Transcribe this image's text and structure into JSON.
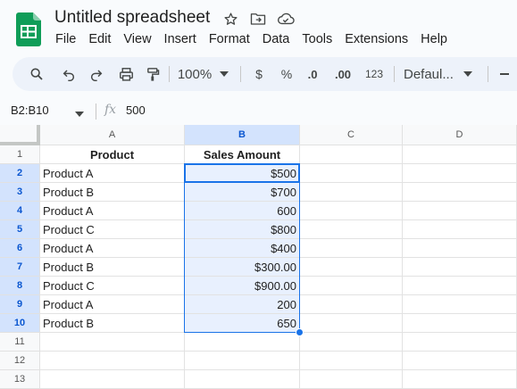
{
  "app": {
    "title": "Untitled spreadsheet",
    "menu": [
      "File",
      "Edit",
      "View",
      "Insert",
      "Format",
      "Data",
      "Tools",
      "Extensions",
      "Help"
    ]
  },
  "toolbar": {
    "zoom": "100%",
    "currency": "$",
    "percent": "%",
    "decrease_decimal": ".0",
    "increase_decimal": ".00",
    "number_format": "123",
    "font": "Defaul..."
  },
  "formula_bar": {
    "name_box": "B2:B10",
    "fx": "fx",
    "value": "500"
  },
  "grid": {
    "columns": [
      "A",
      "B",
      "C",
      "D"
    ],
    "rows": [
      "1",
      "2",
      "3",
      "4",
      "5",
      "6",
      "7",
      "8",
      "9",
      "10",
      "11",
      "12",
      "13"
    ],
    "cells": [
      [
        "Product",
        "Sales Amount"
      ],
      [
        "Product A",
        "$500"
      ],
      [
        "Product B",
        "$700"
      ],
      [
        "Product A",
        "600"
      ],
      [
        "Product C",
        "$800"
      ],
      [
        "Product A",
        "$400"
      ],
      [
        "Product B",
        "$300.00"
      ],
      [
        "Product C",
        "$900.00"
      ],
      [
        "Product A",
        "200"
      ],
      [
        "Product B",
        "650"
      ],
      [
        "",
        ""
      ],
      [
        "",
        ""
      ],
      [
        "",
        ""
      ]
    ],
    "selection": "B2:B10"
  },
  "colors": {
    "accent": "#1a73e8",
    "selection_fill": "#e8f0fe",
    "header_selected": "#d3e3fd",
    "sheets_green": "#0f9d58"
  },
  "icons": [
    "sheets-logo",
    "star-icon",
    "move-folder-icon",
    "cloud-icon",
    "search-icon",
    "undo-icon",
    "redo-icon",
    "print-icon",
    "paint-format-icon",
    "chevron-down-icon"
  ]
}
